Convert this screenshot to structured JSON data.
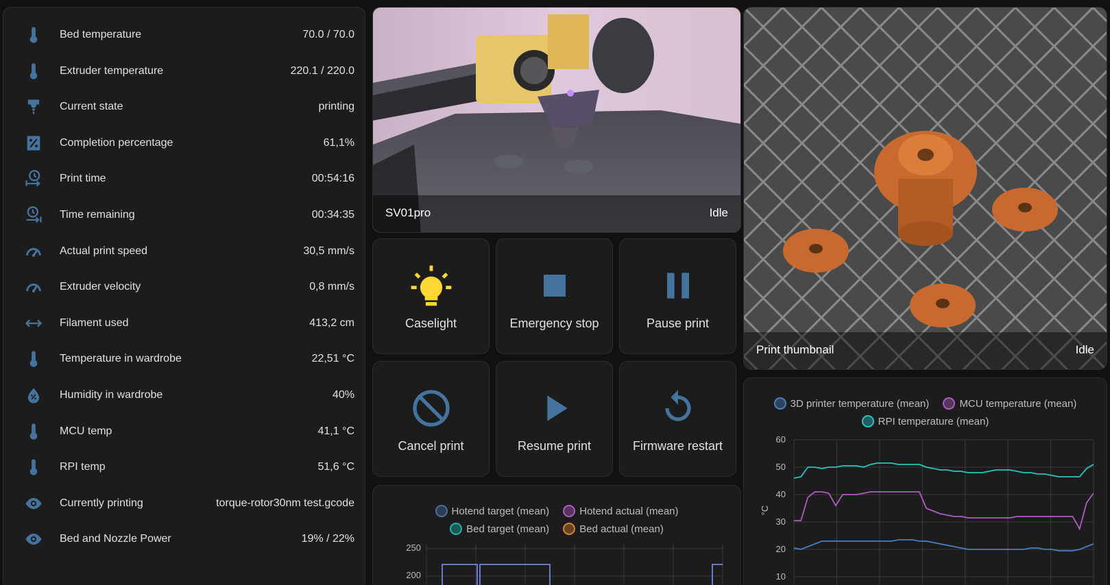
{
  "entities": [
    {
      "icon": "thermometer-icon",
      "label": "Bed temperature",
      "value": "70.0 / 70.0"
    },
    {
      "icon": "thermometer-icon",
      "label": "Extruder temperature",
      "value": "220.1 / 220.0"
    },
    {
      "icon": "printer-nozzle-icon",
      "label": "Current state",
      "value": "printing"
    },
    {
      "icon": "percent-box-icon",
      "label": "Completion percentage",
      "value": "61,1%"
    },
    {
      "icon": "clock-start-icon",
      "label": "Print time",
      "value": "00:54:16"
    },
    {
      "icon": "clock-end-icon",
      "label": "Time remaining",
      "value": "00:34:35"
    },
    {
      "icon": "speedometer-icon",
      "label": "Actual print speed",
      "value": "30,5 mm/s"
    },
    {
      "icon": "speedometer-icon",
      "label": "Extruder velocity",
      "value": "0,8 mm/s"
    },
    {
      "icon": "arrow-left-right-icon",
      "label": "Filament used",
      "value": "413,2 cm"
    },
    {
      "icon": "thermometer-icon",
      "label": "Temperature in wardrobe",
      "value": "22,51 °C"
    },
    {
      "icon": "water-percent-icon",
      "label": "Humidity in wardrobe",
      "value": "40%"
    },
    {
      "icon": "thermometer-icon",
      "label": "MCU temp",
      "value": "41,1 °C"
    },
    {
      "icon": "thermometer-icon",
      "label": "RPI temp",
      "value": "51,6 °C"
    },
    {
      "icon": "eye-icon",
      "label": "Currently printing",
      "value": "torque-rotor30nm test.gcode"
    },
    {
      "icon": "eye-icon",
      "label": "Bed and Nozzle Power",
      "value": "19% / 22%"
    }
  ],
  "camera": {
    "name": "SV01pro",
    "state": "Idle"
  },
  "thumbnail": {
    "name": "Print thumbnail",
    "state": "Idle"
  },
  "buttons": [
    {
      "icon": "lightbulb-on-icon",
      "label": "Caselight",
      "color": "#fdd835"
    },
    {
      "icon": "stop-icon",
      "label": "Emergency stop",
      "color": "#44739e"
    },
    {
      "icon": "pause-icon",
      "label": "Pause print",
      "color": "#44739e"
    },
    {
      "icon": "cancel-icon",
      "label": "Cancel print",
      "color": "#44739e"
    },
    {
      "icon": "play-icon",
      "label": "Resume print",
      "color": "#44739e"
    },
    {
      "icon": "restart-icon",
      "label": "Firmware restart",
      "color": "#44739e"
    }
  ],
  "hotend_chart": {
    "legend": [
      {
        "name": "Hotend target (mean)",
        "color": "#4a6fa5"
      },
      {
        "name": "Hotend actual (mean)",
        "color": "#b05cc4"
      },
      {
        "name": "Bed target (mean)",
        "color": "#1fb5a8"
      },
      {
        "name": "Bed actual (mean)",
        "color": "#d9822b"
      }
    ],
    "y_ticks": [
      "250",
      "200"
    ]
  },
  "chart_data": {
    "type": "line",
    "ylabel": "°C",
    "ylim": [
      10,
      60
    ],
    "y_ticks": [
      "60",
      "50",
      "40",
      "30",
      "20",
      "10"
    ],
    "grid": true,
    "legend_placement": "top",
    "series": [
      {
        "name": "3D printer temperature (mean)",
        "color": "#4a7fc1",
        "values": [
          20.5,
          20,
          21,
          22,
          23,
          23,
          23,
          23,
          23,
          23,
          23,
          23,
          23,
          23,
          23,
          23.5,
          23.5,
          23.5,
          23,
          23,
          22.5,
          22,
          21.5,
          21,
          20.5,
          20,
          20,
          20,
          20,
          20,
          20,
          20,
          20,
          20,
          20.5,
          20.5,
          20,
          20,
          19.5,
          19.5,
          19.5,
          20,
          21,
          22
        ]
      },
      {
        "name": "MCU temperature (mean)",
        "color": "#b05cc4",
        "values": [
          30.5,
          30.5,
          39,
          41,
          41,
          40.5,
          36,
          40,
          40,
          40,
          40.5,
          41,
          41,
          41,
          41,
          41,
          41,
          41,
          41,
          35,
          34,
          33,
          32.5,
          32,
          32,
          31.5,
          31.5,
          31.5,
          31.5,
          31.5,
          31.5,
          31.5,
          32,
          32,
          32,
          32,
          32,
          32,
          32,
          32,
          32,
          27.5,
          37,
          40.5
        ]
      },
      {
        "name": "RPI temperature (mean)",
        "color": "#27c4c4",
        "values": [
          46,
          46.5,
          50,
          50,
          49.5,
          50,
          50,
          50.5,
          50.5,
          50.5,
          50,
          51,
          51.5,
          51.5,
          51.5,
          51,
          51,
          51,
          51,
          50,
          49.5,
          49,
          49,
          48.5,
          48.5,
          48,
          48,
          48,
          48.5,
          49,
          49,
          49,
          48.5,
          48,
          48,
          47.5,
          47.5,
          47,
          46.5,
          46.5,
          46.5,
          46.5,
          49.5,
          51
        ]
      }
    ]
  }
}
